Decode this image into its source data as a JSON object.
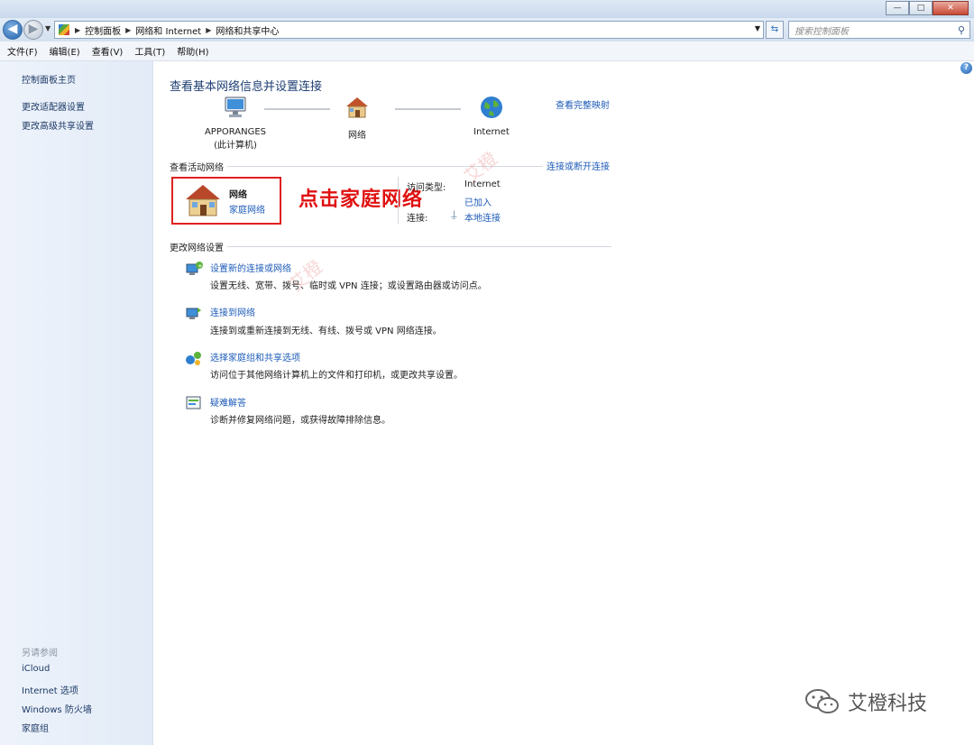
{
  "window": {
    "min": "—",
    "max": "□",
    "close": "✕"
  },
  "address": {
    "crumbs": [
      "控制面板",
      "网络和 Internet",
      "网络和共享中心"
    ],
    "search_placeholder": "搜索控制面板"
  },
  "menu": [
    "文件(F)",
    "编辑(E)",
    "查看(V)",
    "工具(T)",
    "帮助(H)"
  ],
  "left_pane": {
    "links": [
      "控制面板主页",
      "更改适配器设置",
      "更改高级共享设置"
    ],
    "see_also_head": "另请参阅",
    "see_also": [
      "iCloud",
      "Internet 选项",
      "Windows 防火墙",
      "家庭组"
    ]
  },
  "main": {
    "title": "查看基本网络信息并设置连接",
    "map_link": "查看完整映射",
    "nodes": {
      "computer": "APPORANGES",
      "computer_sub": "(此计算机)",
      "network": "网络",
      "internet": "Internet"
    },
    "active_head": "查看活动网络",
    "connect_link": "连接或断开连接",
    "network_name": "网络",
    "network_type": "家庭网络",
    "access_label": "访问类型:",
    "access_value": "Internet",
    "homegroup_label": "家庭组:",
    "homegroup_value": "已加入",
    "conn_label": "连接:",
    "conn_value": "本地连接",
    "callout": "点击家庭网络",
    "change_head": "更改网络设置",
    "tasks": [
      {
        "link": "设置新的连接或网络",
        "desc": "设置无线、宽带、拨号、临时或 VPN 连接；或设置路由器或访问点。"
      },
      {
        "link": "连接到网络",
        "desc": "连接到或重新连接到无线、有线、拨号或 VPN 网络连接。"
      },
      {
        "link": "选择家庭组和共享选项",
        "desc": "访问位于其他网络计算机上的文件和打印机，或更改共享设置。"
      },
      {
        "link": "疑难解答",
        "desc": "诊断并修复网络问题，或获得故障排除信息。"
      }
    ]
  },
  "watermark": "艾橙",
  "brand": "艾橙科技",
  "colors": {
    "link": "#1d5bb8",
    "callout": "#e01010",
    "title": "#1e3f73"
  }
}
